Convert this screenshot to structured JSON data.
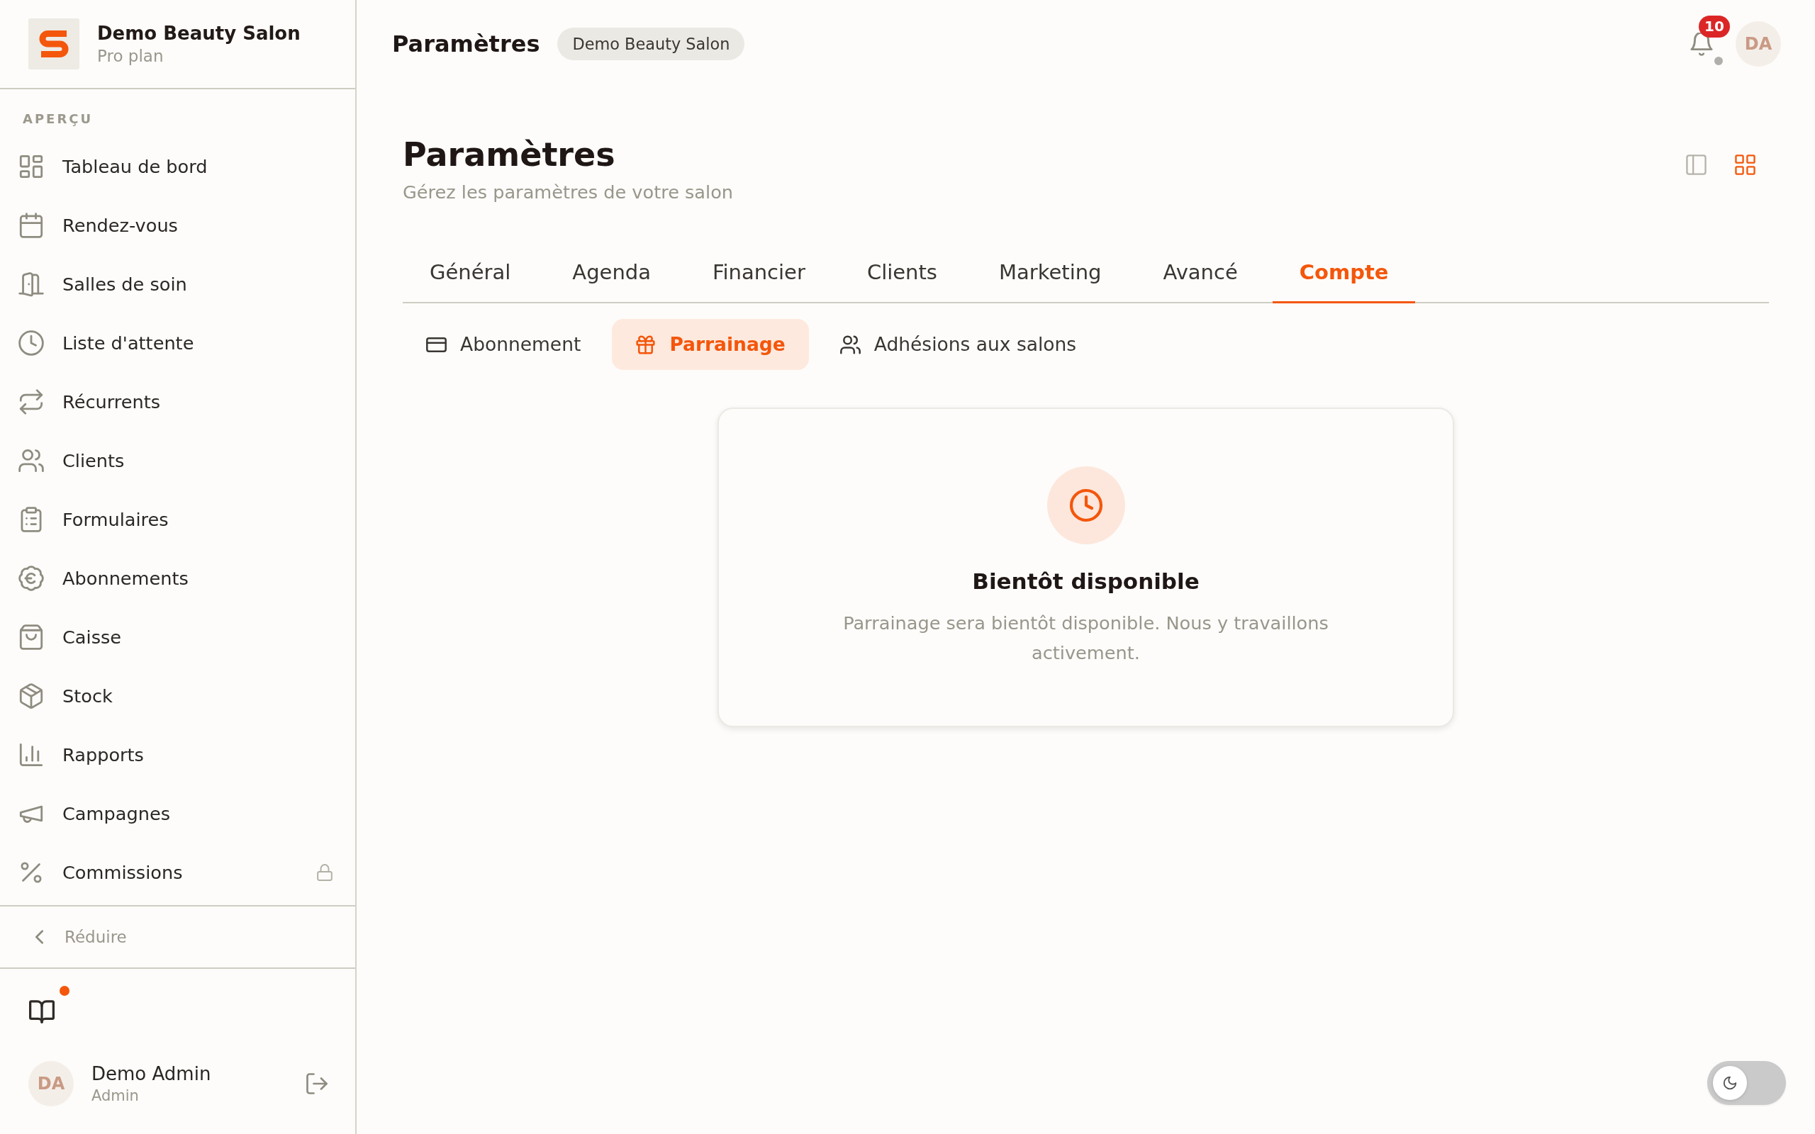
{
  "sidebar": {
    "brand": {
      "name": "Demo Beauty Salon",
      "plan": "Pro plan"
    },
    "section_label": "APERÇU",
    "items": [
      {
        "label": "Tableau de bord",
        "selected": false,
        "locked": false
      },
      {
        "label": "Rendez-vous",
        "selected": false,
        "locked": false
      },
      {
        "label": "Salles de soin",
        "selected": false,
        "locked": false
      },
      {
        "label": "Liste d'attente",
        "selected": false,
        "locked": false
      },
      {
        "label": "Récurrents",
        "selected": false,
        "locked": false
      },
      {
        "label": "Clients",
        "selected": false,
        "locked": false
      },
      {
        "label": "Formulaires",
        "selected": false,
        "locked": false
      },
      {
        "label": "Abonnements",
        "selected": false,
        "locked": false
      },
      {
        "label": "Caisse",
        "selected": false,
        "locked": false
      },
      {
        "label": "Stock",
        "selected": false,
        "locked": false
      },
      {
        "label": "Rapports",
        "selected": false,
        "locked": false
      },
      {
        "label": "Campagnes",
        "selected": false,
        "locked": false
      },
      {
        "label": "Commissions",
        "selected": false,
        "locked": true
      }
    ],
    "collapse_label": "Réduire",
    "guide": {
      "unread": true
    },
    "user": {
      "initials": "DA",
      "name": "Demo Admin",
      "role": "Admin"
    }
  },
  "topbar": {
    "title": "Paramètres",
    "salon": "Demo Beauty Salon",
    "notification_count": "10",
    "avatar_initials": "DA"
  },
  "page": {
    "title": "Paramètres",
    "subtitle": "Gérez les paramètres de votre salon",
    "view_modes": [
      {
        "selected": false
      },
      {
        "selected": true
      }
    ]
  },
  "tabs": [
    {
      "label": "Général",
      "selected": false
    },
    {
      "label": "Agenda",
      "selected": false
    },
    {
      "label": "Financier",
      "selected": false
    },
    {
      "label": "Clients",
      "selected": false
    },
    {
      "label": "Marketing",
      "selected": false
    },
    {
      "label": "Avancé",
      "selected": false
    },
    {
      "label": "Compte",
      "selected": true
    }
  ],
  "subtabs": [
    {
      "label": "Abonnement",
      "selected": false
    },
    {
      "label": "Parrainage",
      "selected": true
    },
    {
      "label": "Adhésions aux salons",
      "selected": false
    }
  ],
  "notice": {
    "title": "Bientôt disponible",
    "message": "Parrainage sera bientôt disponible. Nous y travaillons activement."
  },
  "theme_toggle": {
    "on": false
  }
}
